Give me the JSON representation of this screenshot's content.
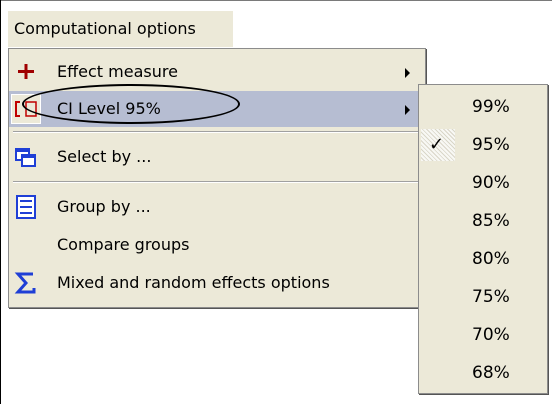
{
  "menubar": {
    "title": "Computational options"
  },
  "menu": {
    "items": [
      {
        "label": "Effect measure",
        "icon": "plus-icon",
        "submenu": true
      },
      {
        "label": "CI Level  95%",
        "icon": "ci-bracket-icon",
        "submenu": true,
        "highlighted": true
      },
      {
        "label": "Select by ...",
        "icon": "select-windows-icon",
        "submenu": false
      },
      {
        "label": "Group by ...",
        "icon": "group-list-icon",
        "submenu": false
      },
      {
        "label": "Compare groups",
        "icon": "",
        "submenu": false
      },
      {
        "label": "Mixed and random effects options",
        "icon": "sigma-icon",
        "submenu": false
      }
    ]
  },
  "submenu": {
    "options": [
      "99%",
      "95%",
      "90%",
      "85%",
      "80%",
      "75%",
      "70%",
      "68%"
    ],
    "selected": "95%"
  },
  "colors": {
    "highlight": "#b6bdd2",
    "menu_bg": "#ece9d8",
    "plus_red": "#a00000",
    "icon_blue": "#1f3fd6"
  }
}
